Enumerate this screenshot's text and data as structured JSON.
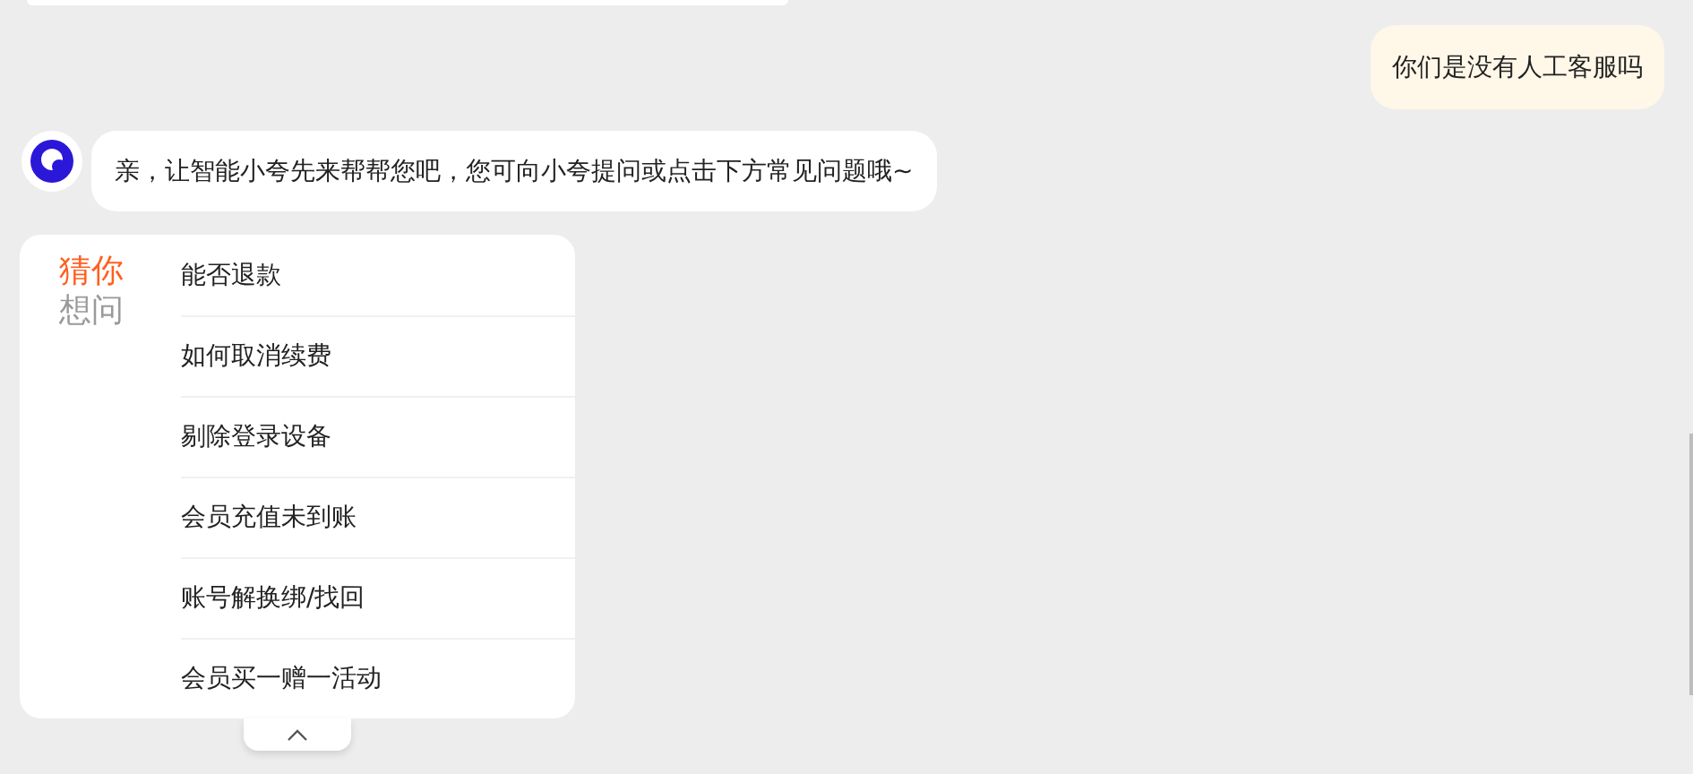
{
  "messages": [
    {
      "kind": "partial"
    },
    {
      "kind": "user",
      "text": "你们是没有人工客服吗"
    },
    {
      "kind": "bot",
      "text": "亲，让智能小夸先来帮帮您吧，您可向小夸提问或点击下方常见问题哦~"
    }
  ],
  "faq": {
    "title_lines": [
      "猜你",
      "想问"
    ],
    "items": [
      "能否退款",
      "如何取消续费",
      "剔除登录设备",
      "会员充值未到账",
      "账号解换绑/找回",
      "会员买一赠一活动"
    ]
  }
}
